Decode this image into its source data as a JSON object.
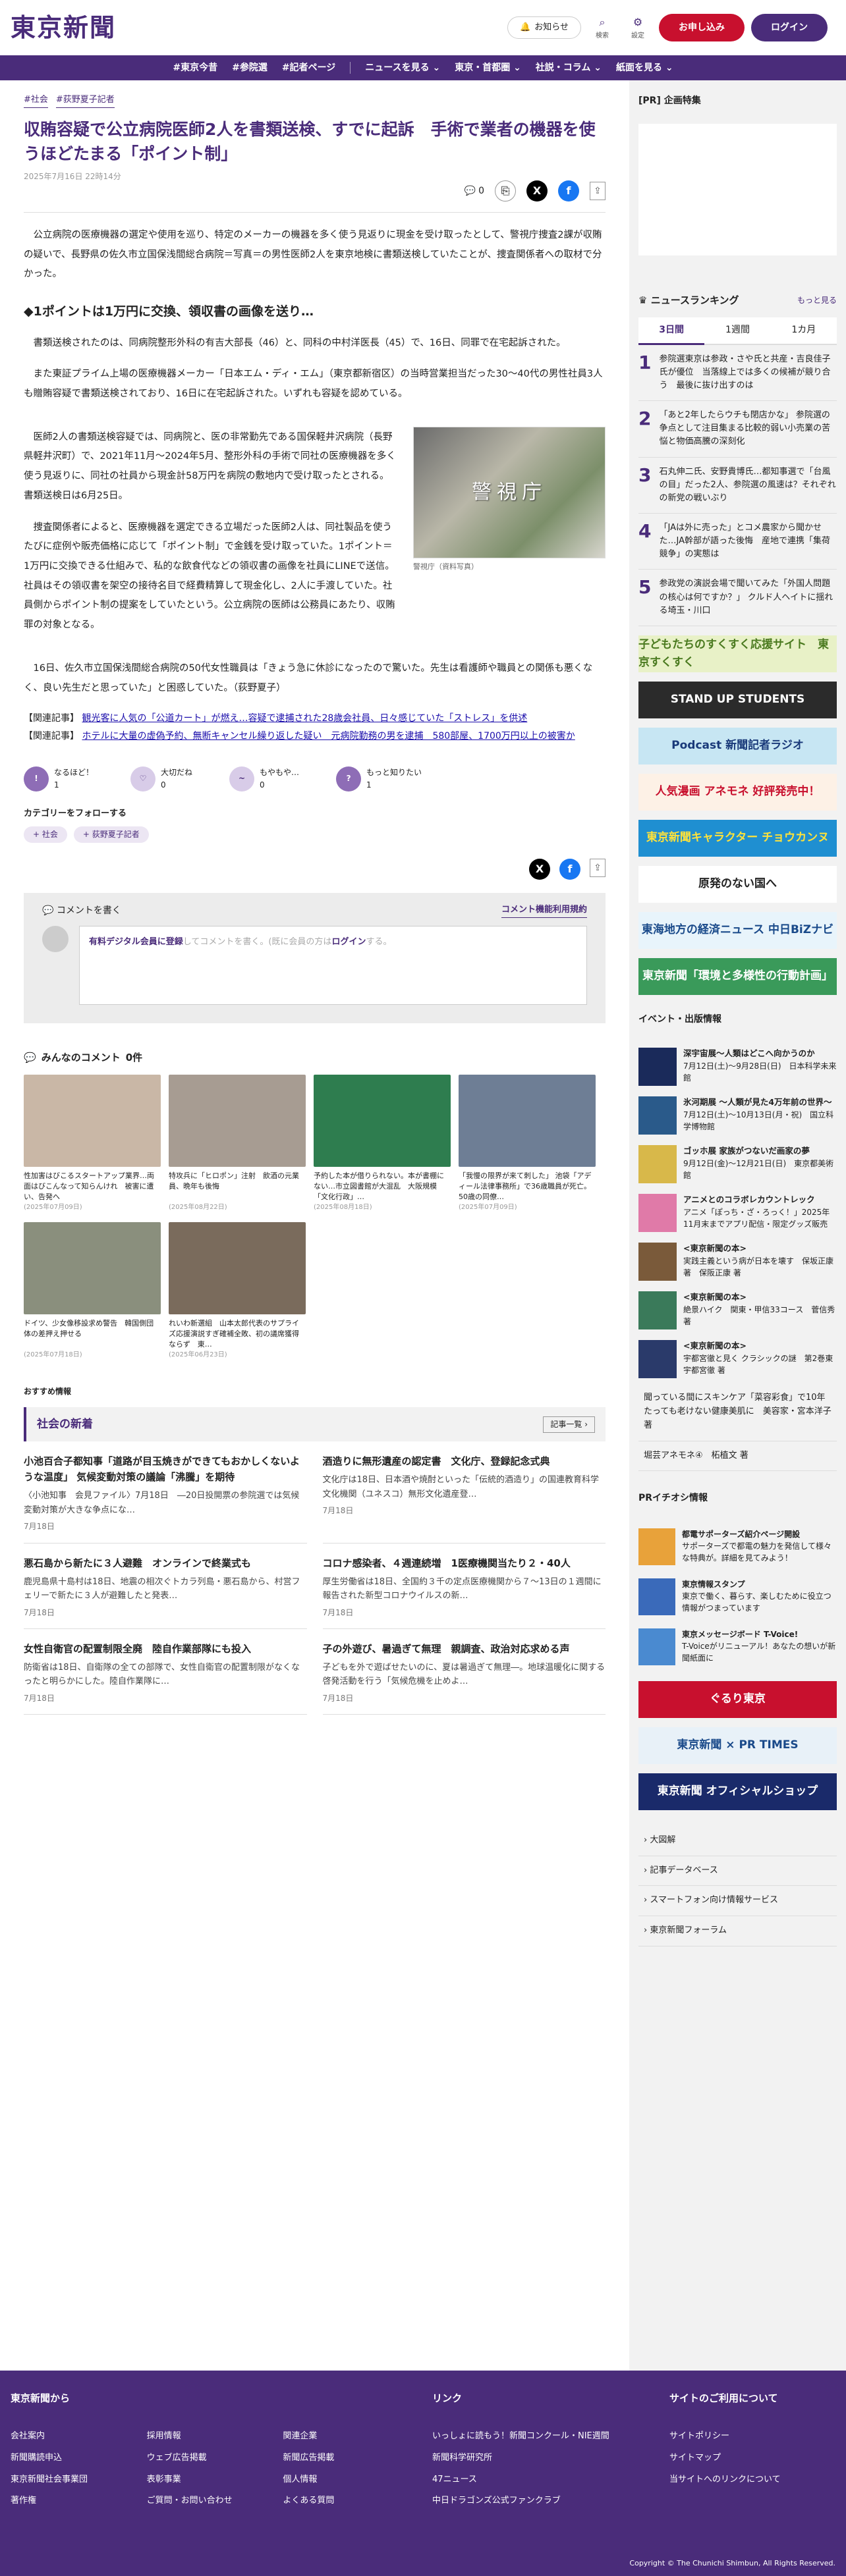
{
  "header": {
    "logo": "東京新聞",
    "notify": "お知らせ",
    "search": "検索",
    "settings": "設定",
    "apply": "お申し込み",
    "login": "ログイン"
  },
  "nav": [
    "#東京今昔",
    "#参院選",
    "#記者ページ",
    "ニュースを見る",
    "東京・首都圏",
    "社説・コラム",
    "紙面を見る"
  ],
  "article": {
    "tags": [
      "#社会",
      "#荻野夏子記者"
    ],
    "title": "収賄容疑で公立病院医師2人を書類送検、すでに起訴　手術で業者の機器を使うほどたまる「ポイント制」",
    "date": "2025年7月16日 22時14分",
    "comment_count": "0",
    "p1": "公立病院の医療機器の選定や使用を巡り、特定のメーカーの機器を多く使う見返りに現金を受け取ったとして、警視庁捜査2課が収賄の疑いで、長野県の佐久市立国保浅間総合病院＝写真＝の男性医師2人を東京地検に書類送検していたことが、捜査関係者への取材で分かった。",
    "h2": "◆1ポイントは1万円に交換、領収書の画像を送り…",
    "p2": "書類送検されたのは、同病院整形外科の有吉大部長（46）と、同科の中村洋医長（45）で、16日、同罪で在宅起訴された。",
    "p3": "また東証プライム上場の医療機器メーカー「日本エム・ディ・エム」（東京都新宿区）の当時営業担当だった30～40代の男性社員3人も贈賄容疑で書類送検されており、16日に在宅起訴された。いずれも容疑を認めている。",
    "p4": "医師2人の書類送検容疑では、同病院と、医の非常勤先である国保軽井沢病院（長野県軽井沢町）で、2021年11月～2024年5月、整形外科の手術で同社の医療機器を多く使う見返りに、同社の社員から現金計58万円を病院の敷地内で受け取ったとされる。書類送検日は6月25日。",
    "p5": "捜査関係者によると、医療機器を選定できる立場だった医師2人は、同社製品を使うたびに症例や販売価格に応じて「ポイント制」で金銭を受け取っていた。1ポイント＝1万円に交換できる仕組みで、私的な飲食代などの領収書の画像を社員にLINEで送信。社員はその領収書を架空の接待名目で経費精算して現金化し、2人に手渡していた。社員側からポイント制の提案をしていたという。公立病院の医師は公務員にあたり、収賄罪の対象となる。",
    "p6": "16日、佐久市立国保浅間総合病院の50代女性職員は「きょう急に休診になったので驚いた。先生は看護師や職員との関係も悪くなく、良い先生だと思っていた」と困惑していた。（荻野夏子）",
    "photo_text": "警視庁",
    "photo_caption": "警視庁（資料写真）",
    "related_prefix": "【関連記事】",
    "related": [
      "観光客に人気の「公道カート」が燃え…容疑で逮捕された28歳会社員、日々感じていた「ストレス」を供述",
      "ホテルに大量の虚偽予約、無断キャンセル繰り返した疑い　元病院勤務の男を逮捕　580部屋、1700万円以上の被害か"
    ]
  },
  "reactions": [
    {
      "label": "なるほど！",
      "count": "1"
    },
    {
      "label": "大切だね",
      "count": "0"
    },
    {
      "label": "もやもや…",
      "count": "0"
    },
    {
      "label": "もっと知りたい",
      "count": "1"
    }
  ],
  "follow": {
    "title": "カテゴリーをフォローする",
    "tags": [
      "社会",
      "荻野夏子記者"
    ]
  },
  "comment_box": {
    "title": "コメントを書く",
    "policy": "コメント機能利用規約",
    "placeholder_pre": "有料デジタル会員に登録",
    "placeholder_mid": "してコメントを書く。(既に会員の方は",
    "placeholder_login": "ログイン",
    "placeholder_post": "する。"
  },
  "comments": {
    "title": "みんなのコメント",
    "count": "0件"
  },
  "thumbs": [
    {
      "t": "性加害はびこるスタートアップ業界…両面はびこんなって知らんけれ　被害に遭い、告発へ",
      "d": "(2025年07月09日)",
      "c": "#c9b7a6"
    },
    {
      "t": "特攻兵に「ヒロポン」注射　飲酒の元業員、晩年も後悔",
      "d": "(2025年08月22日)",
      "c": "#a79c92"
    },
    {
      "t": "予約した本が借りられない。本が書棚にない…市立図書館が大混乱　大阪規模「文化行政」…",
      "d": "(2025年08月18日)",
      "c": "#2e7d4f"
    },
    {
      "t": "「我慢の限界が来て刺した」 池袋「アディール法律事務所」で36歳職員が死亡。50歳の同僚…",
      "d": "(2025年07月09日)",
      "c": "#6e7e95"
    },
    {
      "t": "ドイツ、少女像移設求め警告　韓国側団体の差押え押せる",
      "d": "(2025年07月18日)",
      "c": "#8a8f7d"
    },
    {
      "t": "れいわ新選組　山本太郎代表のサプライズ応援演説すぎ確補全敗、初の議席獲得ならず　東…",
      "d": "(2025年06月23日)",
      "c": "#7a6b5c"
    }
  ],
  "recommend": "おすすめ情報",
  "news": {
    "title": "社会の新着",
    "more": "記事一覧",
    "items": [
      {
        "t": "小池百合子都知事「道路が目玉焼きができてもおかしくないような温度」 気候変動対策の議論「沸騰」を期待",
        "b": "〈小池知事　会見ファイル〉7月18日　―20日投開票の参院選では気候変動対策が大きな争点にな…",
        "d": "7月18日"
      },
      {
        "t": "酒造りに無形遺産の認定書　文化庁、登録記念式典",
        "b": "文化庁は18日、日本酒や焼酎といった「伝統的酒造り」の国連教育科学文化機関（ユネスコ）無形文化遺産登…",
        "d": "7月18日"
      },
      {
        "t": "悪石島から新たに３人避難　オンラインで終業式も",
        "b": "鹿児島県十島村は18日、地震の相次ぐトカラ列島・悪石島から、村営フェリーで新たに３人が避難したと発表…",
        "d": "7月18日"
      },
      {
        "t": "コロナ感染者、４週連続増　1医療機関当たり２・40人",
        "b": "厚生労働省は18日、全国約３千の定点医療機関から７～13日の１週間に報告された新型コロナウイルスの新…",
        "d": "7月18日"
      },
      {
        "t": "女性自衛官の配置制限全廃　陸自作業部隊にも投入",
        "b": "防衛省は18日、自衛隊の全ての部隊で、女性自衛官の配置制限がなくなったと明らかにした。陸自作業隊に…",
        "d": "7月18日"
      },
      {
        "t": "子の外遊び、暑過ぎて無理　親調査、政治対応求める声",
        "b": "子どもを外で遊ばせたいのに、夏は暑過ぎて無理―。地球温暖化に関する啓発活動を行う「気候危機を止めよ…",
        "d": "7月18日"
      }
    ]
  },
  "side": {
    "pr_title": "[PR] 企画特集",
    "ranking_title": "ニュースランキング",
    "ranking_more": "もっと見る",
    "tabs": [
      "3日間",
      "1週間",
      "1カ月"
    ],
    "ranks": [
      "参院選東京は参政・さや氏と共産・吉良佳子氏が優位　当落線上では多くの候補が競り合う　最後に抜け出すのは",
      "「あと2年したらウチも閉店かな」 参院選の争点として注目集まる比較的弱い小売業の苦悩と物価高騰の深刻化",
      "石丸伸二氏、安野貴博氏…都知事選で「台風の目」だった2人、参院選の風速は？それぞれの新党の戦いぶり",
      "「JAは外に売った」とコメ農家から聞かせた…JA幹部が語った後悔　産地で連携「集荷競争」の実態は",
      "参政党の演説会場で聞いてみた「外国人問題の核心は何ですか？」 クルド人ヘイトに揺れる埼玉・川口"
    ],
    "banners": [
      {
        "t": "子どもたちのすくすく応援サイト　東京すくすく",
        "bg": "#e8f1c7",
        "fg": "#4a7a1f"
      },
      {
        "t": "STAND UP STUDENTS",
        "bg": "#2b2b2b",
        "fg": "#ffffff"
      },
      {
        "t": "Podcast 新聞記者ラジオ",
        "bg": "#c7e6f3",
        "fg": "#1a3a7a"
      },
      {
        "t": "人気漫画 アネモネ 好評発売中！",
        "bg": "#fdf1e6",
        "fg": "#c8102e"
      },
      {
        "t": "東京新聞キャラクター チョウカンヌ",
        "bg": "#1f8fd1",
        "fg": "#ffe23a"
      },
      {
        "t": "原発のない国へ",
        "bg": "#fff",
        "fg": "#222"
      },
      {
        "t": "東海地方の経済ニュース 中日BiZナビ",
        "bg": "#e8f4fb",
        "fg": "#1a4a8a"
      },
      {
        "t": "東京新聞「環境と多様性の行動計画」",
        "bg": "#3a9a5a",
        "fg": "#ffffff"
      }
    ],
    "events_title": "イベント・出版情報",
    "events": [
      {
        "t": "深宇宙展〜人類はどこへ向かうのか",
        "s": "7月12日(土)〜9月28日(日)　日本科学未来館",
        "c": "#1a2a5a"
      },
      {
        "t": "氷河期展 〜人類が見た4万年前の世界〜",
        "s": "7月12日(土)〜10月13日(月・祝)　国立科学博物館",
        "c": "#2a5a8a"
      },
      {
        "t": "ゴッホ展 家族がつないだ画家の夢",
        "s": "9月12日(金)〜12月21日(日)　東京都美術館",
        "c": "#d8b84a"
      },
      {
        "t": "アニメとのコラボレカウントレック",
        "s": "アニメ「ぽっち・ざ・ろっく！」2025年11月末までアプリ配信・限定グッズ販売",
        "c": "#e07aa8"
      },
      {
        "t": "<東京新聞の本>",
        "s": "実践主義という病が日本を壊す　保坂正康著　保阪正康 著",
        "c": "#7a5a3a"
      },
      {
        "t": "<東京新聞の本>",
        "s": "絶景ハイク　関東・甲信33コース　菅信秀 著",
        "c": "#3a7a5a"
      },
      {
        "t": "<東京新聞の本>",
        "s": "宇都宮徹と見く クラシックの謎　第2巻東宇都宮徹 著",
        "c": "#2a3a6a"
      }
    ],
    "ticker": "聞っている間にスキンケア「菜容彩食」で10年たっても老けない健康美肌に　美容家・宮本洋子 著",
    "ticker2": "堀芸アネモネ④　柘植文 著",
    "pr2_title": "PRイチオシ情報",
    "prs": [
      {
        "t": "都電サポーターズ紹介ページ開設",
        "s": "サポーターズで都電の魅力を発信して様々な特典が。詳細を見てみよう！",
        "c": "#e8a23a"
      },
      {
        "t": "東京情報スタンプ",
        "s": "東京で働く、暮らす、楽しむために役立つ情報がつまっています",
        "c": "#3a6aba"
      },
      {
        "t": "東京メッセージボード T-Voice!",
        "s": "T-Voiceがリニューアル！あなたの想いが新聞紙面に",
        "c": "#4a8ad0"
      }
    ],
    "bottom_banners": [
      {
        "t": "ぐるり東京",
        "bg": "#c8102e",
        "fg": "#ffffff"
      },
      {
        "t": "東京新聞 × PR TIMES",
        "bg": "#e8f1f8",
        "fg": "#1a4a8a"
      },
      {
        "t": "東京新聞 オフィシャルショップ",
        "bg": "#1a2a6a",
        "fg": "#ffffff"
      }
    ],
    "links": [
      "大図解",
      "記事データベース",
      "スマートフォン向け情報サービス",
      "東京新聞フォーラム"
    ]
  },
  "footer": {
    "c1_title": "東京新聞から",
    "c1": [
      "会社案内",
      "採用情報",
      "関連企業",
      "新聞購読申込",
      "ウェブ広告掲載",
      "新聞広告掲載",
      "東京新聞社会事業団",
      "表彰事業",
      "個人情報",
      "著作権",
      "ご質問・お問い合わせ",
      "よくある質問"
    ],
    "c2_title": "リンク",
    "c2": [
      "いっしょに読もう！新聞コンクール・NIE週間",
      "新聞科学研究所",
      "47ニュース",
      "中日ドラゴンズ公式ファンクラブ"
    ],
    "c3_title": "サイトのご利用について",
    "c3": [
      "サイトポリシー",
      "サイトマップ",
      "当サイトへのリンクについて"
    ],
    "copyright": "Copyright © The Chunichi Shimbun, All Rights Reserved."
  }
}
